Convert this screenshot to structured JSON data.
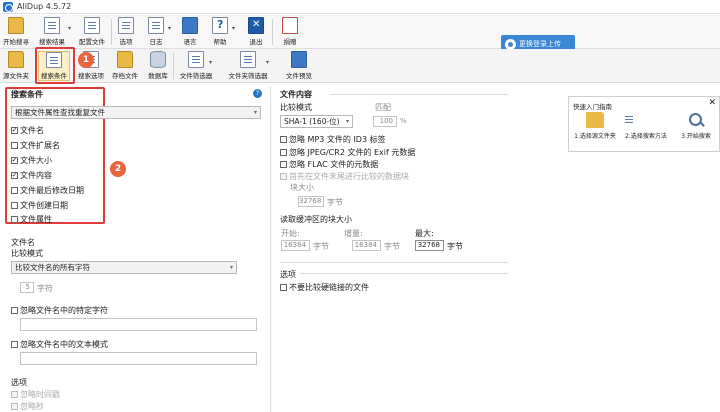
{
  "window": {
    "title": "AllDup 4.5.72"
  },
  "toolbar1": [
    {
      "label": "开始搜寻"
    },
    {
      "label": "搜索结果"
    },
    {
      "label": "配置文件"
    },
    {
      "label": "选项"
    },
    {
      "label": "日志"
    },
    {
      "label": "语言"
    },
    {
      "label": "帮助"
    },
    {
      "label": "退出"
    },
    {
      "label": "捐赠"
    }
  ],
  "toolbar2": [
    {
      "label": "源文件夹"
    },
    {
      "label": "搜索条件"
    },
    {
      "label": "搜索选项"
    },
    {
      "label": "存档文件"
    },
    {
      "label": "数据库"
    },
    {
      "label": "文件筛选器"
    },
    {
      "label": "文件夹筛选器"
    },
    {
      "label": "文件预览"
    }
  ],
  "upload_button": {
    "label": "更换登录上传"
  },
  "annotations": {
    "badge1": "1",
    "badge2": "2"
  },
  "criteria": {
    "title": "搜索条件",
    "mode_select": "根据文件属性查找重复文件",
    "options": [
      {
        "label": "文件名",
        "checked": true
      },
      {
        "label": "文件扩展名",
        "checked": false
      },
      {
        "label": "文件大小",
        "checked": true
      },
      {
        "label": "文件内容",
        "checked": true
      },
      {
        "label": "文件最后修改日期",
        "checked": false
      },
      {
        "label": "文件创建日期",
        "checked": false
      },
      {
        "label": "文件属性",
        "checked": false
      }
    ]
  },
  "filename": {
    "title": "文件名",
    "compare_mode_label": "比较模式",
    "compare_mode_value": "比较文件名的所有字符",
    "chars_value": "5",
    "chars_unit": "字符",
    "ignore_specific": "忽略文件名中的特定字符",
    "ignore_text_pattern": "忽略文件名中的文本模式"
  },
  "options_left": {
    "title": "选项",
    "ignore_time": "忽略时间戳",
    "ignore_seconds": "忽略秒"
  },
  "file_content": {
    "title": "文件内容",
    "compare_mode_label": "比较模式",
    "match_label": "匹配",
    "hash_select": "SHA-1 (160-位)",
    "match_value": "100",
    "match_unit": "%",
    "ignore_id3": "忽略 MP3 文件的 ID3 标签",
    "ignore_exif": "忽略 JPEG/CR2 文件的 Exif 元数据",
    "ignore_flac": "忽略 FLAC 文件的元数据",
    "compare_end_line1": "首先在文件末尾进行比较的数据块",
    "compare_end_line2": "块大小",
    "block_size_value": "32768",
    "block_unit": "字节",
    "buffer_title": "读取缓冲区的块大小",
    "start_label": "开始:",
    "increase_label": "增量:",
    "max_label": "最大:",
    "start_value": "16384",
    "increase_value": "16384",
    "max_value": "32768",
    "byte_unit": "字节"
  },
  "options_right": {
    "title": "选项",
    "no_hardlink": "不要比较硬链接的文件"
  },
  "quick_guide": {
    "title": "快速入门指南",
    "close": "✕",
    "steps": [
      {
        "label": "1.选择源文件夹"
      },
      {
        "label": "2.选择搜索方法"
      },
      {
        "label": "3.开始搜索"
      }
    ]
  }
}
